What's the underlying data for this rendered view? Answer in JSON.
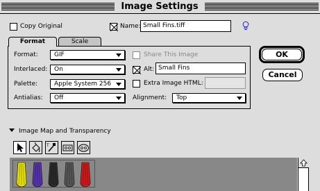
{
  "window": {
    "title": "Image Settings"
  },
  "copy_original": {
    "label": "Copy Original",
    "checked": false
  },
  "name_field": {
    "label": "Name:",
    "checked": true,
    "value": "Small Fins.tiff"
  },
  "tabs": [
    {
      "label": "Format",
      "active": true
    },
    {
      "label": "Scale",
      "active": false
    }
  ],
  "format": {
    "format": {
      "label": "Format:",
      "value": "GIF"
    },
    "interlaced": {
      "label": "Interlaced:",
      "value": "On"
    },
    "palette": {
      "label": "Palette:",
      "value": "Apple System 256"
    },
    "antialias": {
      "label": "Antialias:",
      "value": "Off"
    }
  },
  "share_image": {
    "label": "Share This Image",
    "checked": false,
    "enabled": false
  },
  "alt": {
    "label": "Alt:",
    "checked": true,
    "value": "Small Fins"
  },
  "extra_html": {
    "label": "Extra Image HTML:",
    "checked": false,
    "value": ""
  },
  "alignment": {
    "label": "Alignment:",
    "value": "Top"
  },
  "buttons": {
    "ok": "OK",
    "cancel": "Cancel"
  },
  "image_map": {
    "label": "Image Map and Transparency"
  },
  "tools": [
    "arrow-tool-icon",
    "paint-bucket-icon",
    "eyedropper-icon",
    "rectangle-map-icon",
    "oval-map-icon"
  ],
  "fins": [
    {
      "color": "#e6e000"
    },
    {
      "color": "#5533aa"
    },
    {
      "color": "#2a2a2a"
    },
    {
      "color": "#555555"
    },
    {
      "color": "#cc1a1a"
    }
  ]
}
